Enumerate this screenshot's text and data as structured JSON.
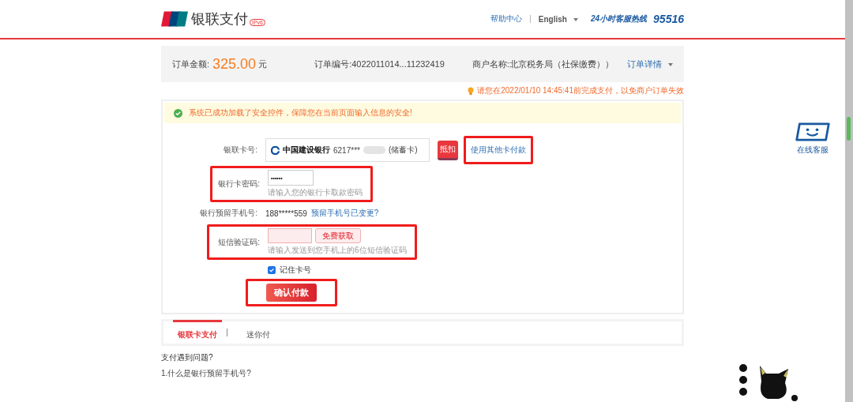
{
  "header": {
    "brand": "银联支付",
    "brand_badge": "IPv6",
    "links": [
      {
        "label": "帮助中心",
        "kind": "link"
      },
      {
        "label": "English",
        "kind": "dropdown"
      }
    ],
    "hotline_label": "24小时客服热线",
    "hotline_number": "95516"
  },
  "order": {
    "amount_label": "订单金额:",
    "amount": "325.00",
    "currency": "元",
    "number_label": "订单编号:",
    "number": "4022011014...11232419",
    "merchant_label": "商户名称:",
    "merchant": "北京税务局（社保缴费））",
    "details": "订单详情"
  },
  "deadline": "请您在2022/01/10 14:45:41前完成支付，以免商户订单失效",
  "notice": "系统已成功加载了安全控件，保障您在当前页面输入信息的安全!",
  "form": {
    "card_label": "银联卡号:",
    "bank_name": "中国建设银行",
    "card_number": "6217***",
    "card_type": "(储蓄卡)",
    "discount_tag": "抵扣",
    "other_card": "使用其他卡付款",
    "password_label": "银行卡密码:",
    "password_value": "••••••",
    "password_hint": "请输入您的银行卡取款密码",
    "phone_label": "银行预留手机号:",
    "phone": "188*****559",
    "phone_changed": "预留手机号已变更?",
    "sms_label": "短信验证码:",
    "sms_button": "免费获取",
    "sms_hint": "请输入发送到您手机上的6位短信验证码",
    "remember": {
      "label": "记住卡号",
      "checked": true
    },
    "submit": "确认付款"
  },
  "tabs": [
    {
      "label": "银联卡支付",
      "selected": true
    },
    {
      "label": "迷你付",
      "selected": false
    }
  ],
  "faq": {
    "title": "支付遇到问题?",
    "questions": [
      "1.什么是银行预留手机号?"
    ]
  },
  "service": {
    "label": "在线客服"
  }
}
